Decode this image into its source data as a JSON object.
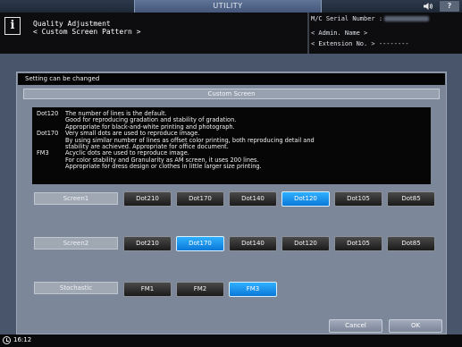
{
  "topbar": {
    "utility_label": "UTILITY",
    "speaker_icon": "speaker-icon",
    "help_label": "?"
  },
  "header": {
    "title_line1": "Quality Adjustment",
    "title_line2": "< Custom Screen Pattern >",
    "serial_label": "M/C Serial Number :",
    "admin_label": "< Admin. Name >",
    "extension_label": "< Extension No. >",
    "extension_value": "--------"
  },
  "status_text": "Setting can be changed",
  "section_title": "Custom Screen",
  "descriptions": [
    {
      "key": "Dot120",
      "lines": [
        "The number of lines is the default.",
        "Good for reproducing gradation and stability of gradation.",
        "Appropriate for black-and-white printing and photograph."
      ]
    },
    {
      "key": "Dot170",
      "lines": [
        "Very small dots are used to reproduce image.",
        "By using similar number of lines as offset color printing, both reproducing detail and",
        "stability are achieved. Appropriate for office document."
      ]
    },
    {
      "key": "FM3",
      "lines": [
        "Acyclic dots are used to reproduce image.",
        "For color stability and Granularity as AM screen, it uses 200 lines.",
        "Appropriate for dress design or clothes in little larger size printing."
      ]
    }
  ],
  "screen1": {
    "label": "Screen1",
    "options": [
      "Dot210",
      "Dot170",
      "Dot140",
      "Dot120",
      "Dot105",
      "Dot85"
    ],
    "selected": "Dot120"
  },
  "screen2": {
    "label": "Screen2",
    "options": [
      "Dot210",
      "Dot170",
      "Dot140",
      "Dot120",
      "Dot105",
      "Dot85"
    ],
    "selected": "Dot170"
  },
  "stochastic": {
    "label": "Stochastic",
    "options": [
      "FM1",
      "FM2",
      "FM3"
    ],
    "selected": "FM3"
  },
  "buttons": {
    "cancel": "Cancel",
    "ok": "OK"
  },
  "footer": {
    "time": "16:12"
  },
  "colors": {
    "selected": "#1a96f0",
    "background": "#49556a",
    "panel": "#7c8799"
  }
}
